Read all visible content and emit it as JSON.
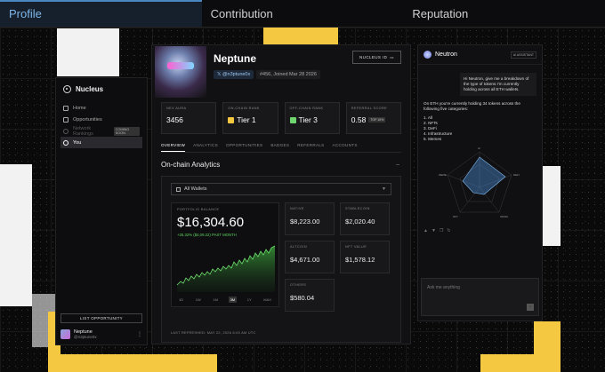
{
  "tabs": [
    {
      "label": "Profile",
      "active": true
    },
    {
      "label": "Contribution",
      "active": false
    },
    {
      "label": "Reputation",
      "active": false
    }
  ],
  "colors": {
    "accent_yellow": "#f5c842",
    "positive": "#5fd35f",
    "tab_active": "#7fb6ea"
  },
  "sidebar": {
    "brand": "Nucleus",
    "items": [
      {
        "label": "Home",
        "icon": "home-icon"
      },
      {
        "label": "Opportunities",
        "icon": "grid-icon"
      },
      {
        "label": "Network Rankings",
        "icon": "heart-icon",
        "badge": "COMING SOON",
        "disabled": true
      },
      {
        "label": "You",
        "icon": "user-icon",
        "active": true
      }
    ],
    "list_button": "LIST OPPORTUNITY",
    "user": {
      "name": "Neptune",
      "handle": "@n3ptune0x"
    }
  },
  "profile": {
    "name": "Neptune",
    "handle": "@n3ptune0x",
    "joined": "#456, Joined Mar 28 2026",
    "nucleus_id_label": "NUCLEUS ID",
    "stats": [
      {
        "label": "NEX AURA",
        "value": "3456"
      },
      {
        "label": "ON-CHAIN RANK",
        "value": "Tier 1"
      },
      {
        "label": "OFF-CHAIN RANK",
        "value": "Tier 3"
      },
      {
        "label": "REFERRAL SCORE",
        "value": "0.58",
        "badge": "TOP 10%"
      }
    ],
    "subtabs": [
      "OVERVIEW",
      "ANALYTICS",
      "OPPORTUNITIES",
      "BADGES",
      "REFERRALS",
      "ACCOUNTS"
    ],
    "section_title": "On-chain Analytics",
    "wallet_select": "All Wallets",
    "balance": {
      "label": "PORTFOLIO BALANCE",
      "value": "$16,304.60",
      "change": "+25.32% ($4,09.22) PAST MONTH",
      "ranges": [
        "1D",
        "1W",
        "1M",
        "3M",
        "1Y",
        "MAX"
      ],
      "active_range": "3M"
    },
    "assets": [
      {
        "label": "NATIVE",
        "value": "$8,223.00"
      },
      {
        "label": "STABLECOIN",
        "value": "$2,020.40"
      },
      {
        "label": "ALTCOIN",
        "value": "$4,671.00"
      },
      {
        "label": "NFT VALUE",
        "value": "$1,578.12"
      },
      {
        "label": "OTHERS",
        "value": "$580.04"
      }
    ],
    "refreshed": "LAST REFRESHED: MAY 22, 2026 6:00 AM UTC"
  },
  "chat": {
    "title": "Neutron",
    "badge": "AI ASSISTANT",
    "user_message": "Hi Neutron, give me a breakdown of the type of tokens I'm currently holding across all ETH wallets.",
    "ai_intro": "On ETH you're currently holding 34 tokens across the following five categories:",
    "ai_list": [
      "1. All",
      "2. NFTs",
      "3. DeFi",
      "4. Infrastructure",
      "5. Memes"
    ],
    "radar_labels": [
      "AI",
      "DEFI",
      "INFRA",
      "NFT",
      "MEME"
    ],
    "placeholder": "Ask me anything"
  }
}
